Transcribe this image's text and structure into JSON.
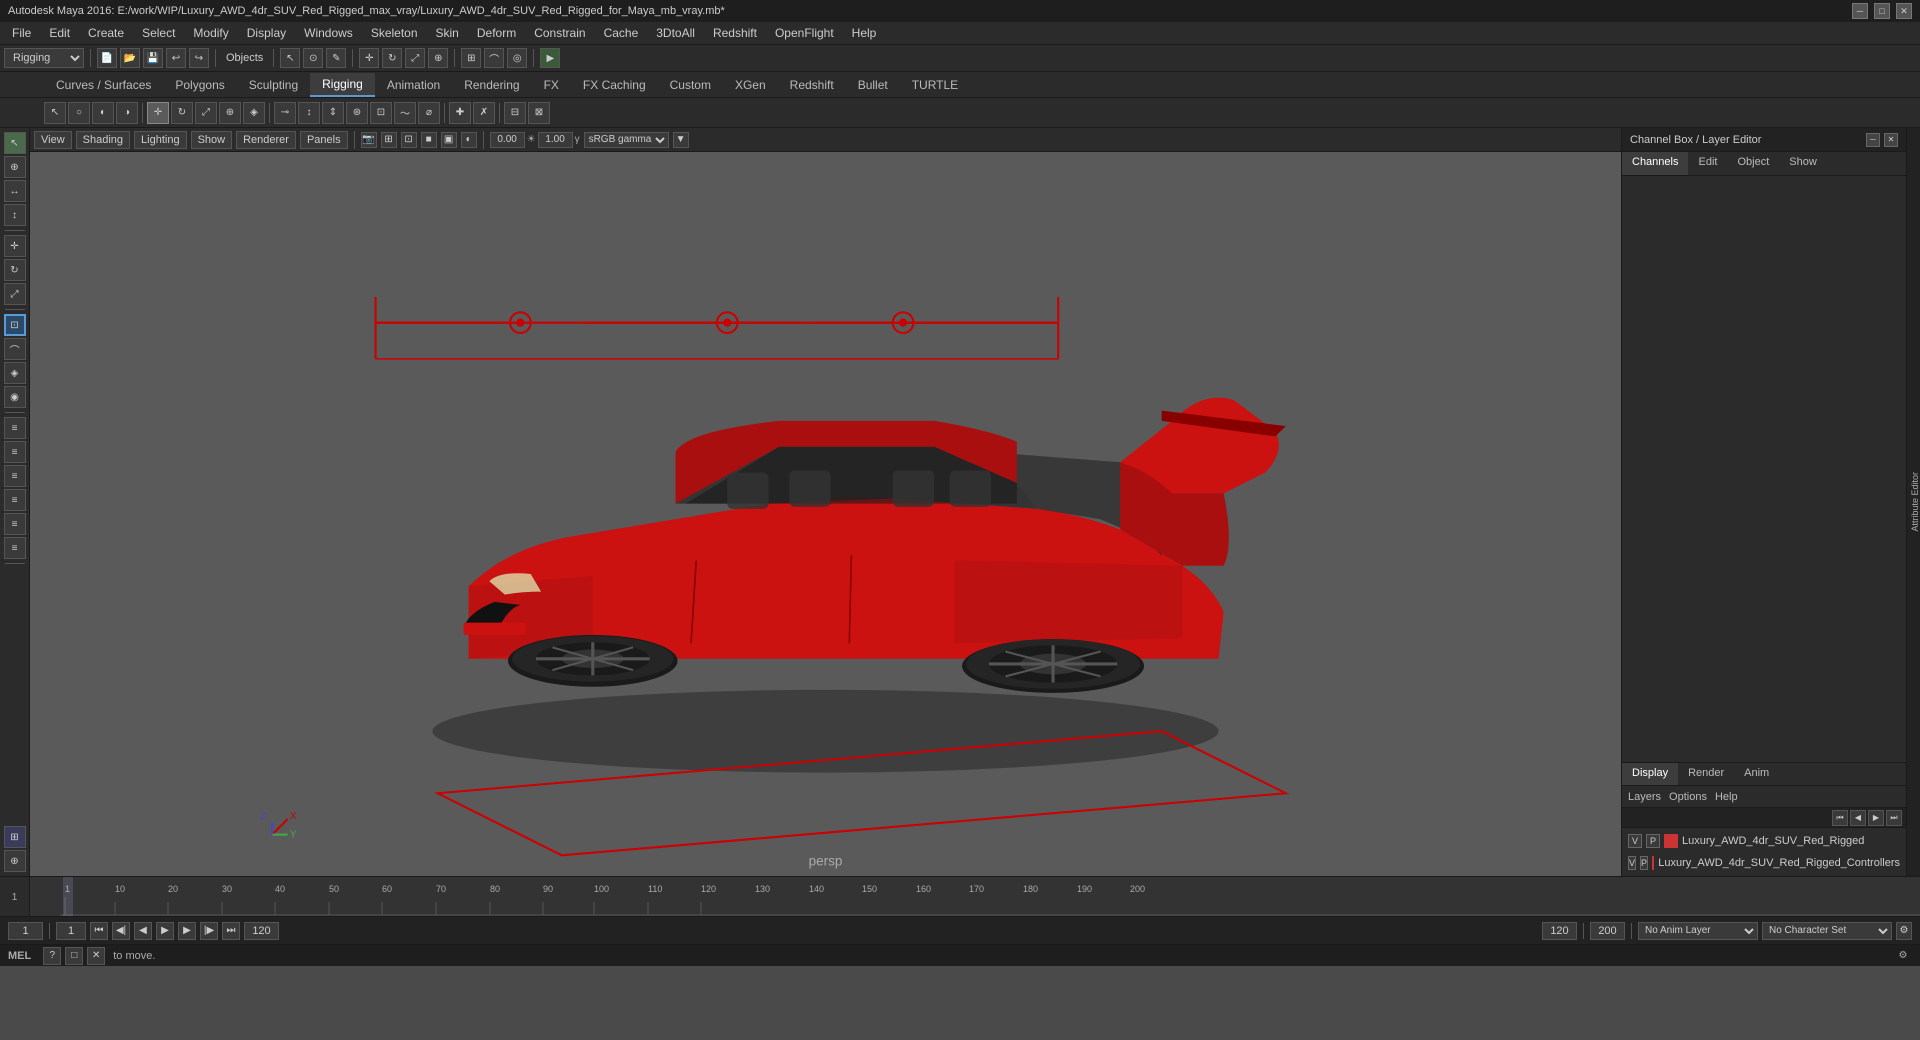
{
  "window": {
    "title": "Autodesk Maya 2016: E:/work/WIP/Luxury_AWD_4dr_SUV_Red_Rigged_max_vray/Luxury_AWD_4dr_SUV_Red_Rigged_for_Maya_mb_vray.mb*"
  },
  "menu": {
    "items": [
      "File",
      "Edit",
      "Create",
      "Select",
      "Modify",
      "Display",
      "Windows",
      "Skeleton",
      "Skin",
      "Deform",
      "Constrain",
      "Cache",
      "3DtoAll",
      "Redshift",
      "OpenFlight",
      "Help"
    ]
  },
  "toolbar": {
    "mode_select": "Rigging",
    "objects_label": "Objects"
  },
  "mode_tabs": {
    "items": [
      "Curves / Surfaces",
      "Polygons",
      "Sculpting",
      "Rigging",
      "Animation",
      "Rendering",
      "FX",
      "FX Caching",
      "Custom",
      "XGen",
      "Redshift",
      "Bullet",
      "TURTLE"
    ],
    "active": "Rigging"
  },
  "viewport": {
    "menu_items": [
      "View",
      "Shading",
      "Lighting",
      "Show",
      "Renderer",
      "Panels"
    ],
    "label": "persp",
    "color_profile": "sRGB gamma",
    "exposure": "0.00",
    "gamma": "1.00"
  },
  "right_panel": {
    "title": "Channel Box / Layer Editor",
    "tabs": [
      "Channels",
      "Edit",
      "Object",
      "Show"
    ],
    "layer_tabs": [
      "Display",
      "Render",
      "Anim"
    ],
    "active_layer_tab": "Display",
    "layer_options": [
      "Layers",
      "Options",
      "Help"
    ],
    "layers": [
      {
        "v": "V",
        "p": "P",
        "color": "#cc3333",
        "name": "Luxury_AWD_4dr_SUV_Red_Rigged"
      },
      {
        "v": "V",
        "p": "P",
        "color": "#cc3333",
        "name": "Luxury_AWD_4dr_SUV_Red_Rigged_Controllers"
      }
    ]
  },
  "timeline": {
    "ticks": [
      "1",
      "10",
      "20",
      "30",
      "40",
      "50",
      "60",
      "70",
      "80",
      "90",
      "100",
      "110",
      "120",
      "130",
      "140",
      "150",
      "160",
      "170",
      "180",
      "190",
      "200"
    ],
    "current_frame": "1",
    "start_frame": "1",
    "end_frame": "120",
    "range_end": "200",
    "anim_layer": "No Anim Layer",
    "character_set": "No Character Set"
  },
  "status_bar": {
    "mel_label": "MEL",
    "message": "to move."
  },
  "icons": {
    "move": "✛",
    "rotate": "↻",
    "scale": "⤢",
    "select": "↖",
    "lasso": "○",
    "paint": "✏",
    "close": "✕",
    "minimize": "─",
    "maximize": "□",
    "play": "▶",
    "prev": "◀",
    "next": "▶",
    "first": "⏮",
    "last": "⏭",
    "rewind": "◀◀",
    "forward": "▶▶"
  }
}
